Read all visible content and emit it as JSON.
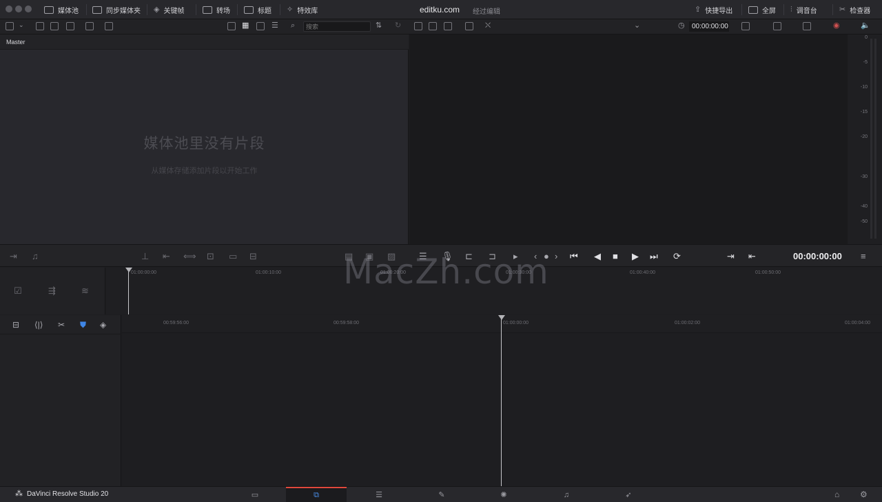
{
  "window": {
    "title": "editku.com",
    "subtitle": "经过编辑"
  },
  "topbar": {
    "left_tabs": [
      {
        "label": "媒体池",
        "icon": "media-pool-icon"
      },
      {
        "label": "同步媒体夹",
        "icon": "sync-bin-icon"
      },
      {
        "label": "关键帧",
        "icon": "keyframe-icon"
      },
      {
        "label": "转场",
        "icon": "transition-icon"
      },
      {
        "label": "标题",
        "icon": "title-icon"
      },
      {
        "label": "特效库",
        "icon": "effects-icon"
      }
    ],
    "right_tabs": [
      {
        "label": "快捷导出",
        "icon": "export-icon"
      },
      {
        "label": "全屏",
        "icon": "fullscreen-icon"
      },
      {
        "label": "调音台",
        "icon": "mixer-icon"
      },
      {
        "label": "检查器",
        "icon": "inspector-icon"
      }
    ]
  },
  "toolbar2": {
    "search_placeholder": "搜索",
    "viewer_timecode": "00:00:00:00"
  },
  "mediapool": {
    "bin_label": "Master",
    "empty_title": "媒体池里没有片段",
    "empty_subtitle": "从媒体存储添加片段以开始工作"
  },
  "audiometer": {
    "labels": [
      "0",
      "-5",
      "-10",
      "-15",
      "-20",
      "-30",
      "-40",
      "-50"
    ]
  },
  "viewer": {
    "timecode": "00:00:00:00"
  },
  "timeline": {
    "upper_ruler": [
      "01:00:00:00",
      "01:00:10:00",
      "01:00:20:00",
      "01:00:30:00",
      "01:00:40:00",
      "01:00:50:00"
    ],
    "lower_ruler": [
      "00:59:56:00",
      "00:59:58:00",
      "01:00:00:00",
      "01:00:02:00",
      "01:00:04:00"
    ]
  },
  "bottombar": {
    "brand": "DaVinci Resolve Studio 20",
    "pages": [
      "media-page-icon",
      "cut-page-icon",
      "edit-page-icon",
      "fusion-page-icon",
      "color-page-icon",
      "fairlight-page-icon",
      "deliver-page-icon"
    ],
    "active_page": "cut-page-icon"
  },
  "watermark": "MacZh.com",
  "colors": {
    "accent_red": "#e0483c",
    "accent_blue": "#4a8ee8"
  }
}
